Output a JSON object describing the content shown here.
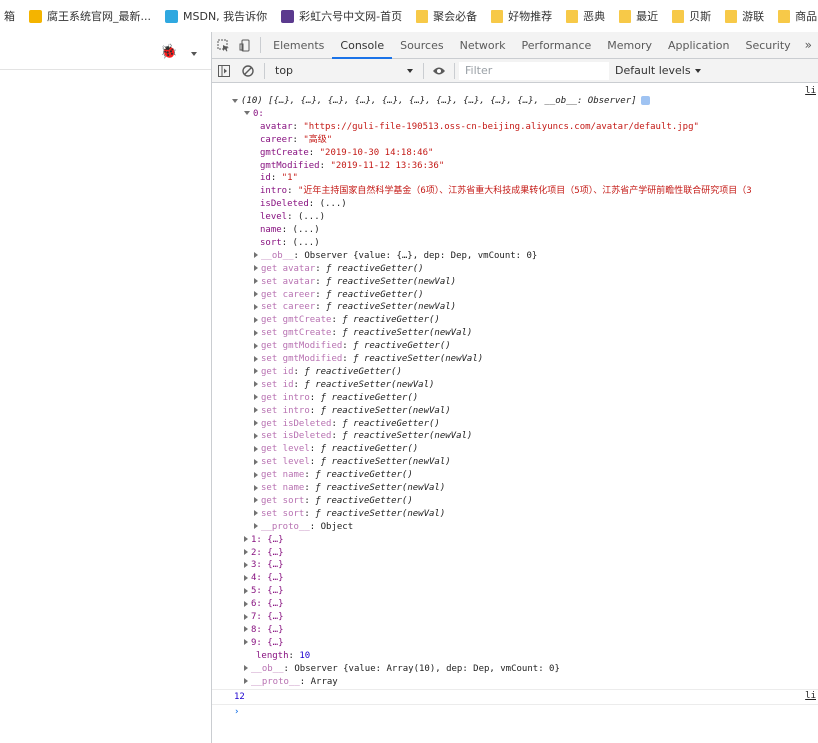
{
  "bookmarks": [
    {
      "label": "箱",
      "color": "#ffffff"
    },
    {
      "label": "腐王系统官网_最新...",
      "color": "#f4b400"
    },
    {
      "label": "MSDN, 我告诉你",
      "color": "#2fa8e0"
    },
    {
      "label": "彩虹六号中文网-首页",
      "color": "#5b3a8e"
    },
    {
      "label": "聚会必备",
      "color": "#f7c948"
    },
    {
      "label": "好物推荐",
      "color": "#f7c948"
    },
    {
      "label": "恶典",
      "color": "#f7c948"
    },
    {
      "label": "最近",
      "color": "#f7c948"
    },
    {
      "label": "贝斯",
      "color": "#f7c948"
    },
    {
      "label": "游联",
      "color": "#f7c948"
    },
    {
      "label": "商品",
      "color": "#f7c948"
    }
  ],
  "devtools": {
    "tabs": [
      "Elements",
      "Console",
      "Sources",
      "Network",
      "Performance",
      "Memory",
      "Application",
      "Security"
    ],
    "active_tab": "Console",
    "more": "»",
    "context": "top",
    "filter_placeholder": "Filter",
    "levels": "Default levels"
  },
  "console": {
    "header": "(10) [{…}, {…}, {…}, {…}, {…}, {…}, {…}, {…}, {…}, {…}, __ob__: Observer]",
    "source": "li",
    "item0_key": "0:",
    "fields": [
      {
        "key": "avatar",
        "value": "\"https://guli-file-190513.oss-cn-beijing.aliyuncs.com/avatar/default.jpg\"",
        "type": "str"
      },
      {
        "key": "career",
        "value": "\"高级\"",
        "type": "str"
      },
      {
        "key": "gmtCreate",
        "value": "\"2019-10-30 14:18:46\"",
        "type": "str"
      },
      {
        "key": "gmtModified",
        "value": "\"2019-11-12 13:36:36\"",
        "type": "str"
      },
      {
        "key": "id",
        "value": "\"1\"",
        "type": "str"
      },
      {
        "key": "intro",
        "value": "\"近年主持国家自然科学基金（6项）、江苏省重大科技成果转化项目（5项）、江苏省产学研前瞻性联合研究项目（3",
        "type": "str"
      },
      {
        "key": "isDeleted",
        "value": "(...)",
        "type": "plain"
      },
      {
        "key": "level",
        "value": "(...)",
        "type": "plain"
      },
      {
        "key": "name",
        "value": "(...)",
        "type": "plain"
      },
      {
        "key": "sort",
        "value": "(...)",
        "type": "plain"
      }
    ],
    "observer_line": {
      "key": "__ob__",
      "value": "Observer {value: {…}, dep: Dep, vmCount: 0}"
    },
    "accessors": [
      {
        "key": "get avatar",
        "value": "reactiveGetter()"
      },
      {
        "key": "set avatar",
        "value": "reactiveSetter(newVal)"
      },
      {
        "key": "get career",
        "value": "reactiveGetter()"
      },
      {
        "key": "set career",
        "value": "reactiveSetter(newVal)"
      },
      {
        "key": "get gmtCreate",
        "value": "reactiveGetter()"
      },
      {
        "key": "set gmtCreate",
        "value": "reactiveSetter(newVal)"
      },
      {
        "key": "get gmtModified",
        "value": "reactiveGetter()"
      },
      {
        "key": "set gmtModified",
        "value": "reactiveSetter(newVal)"
      },
      {
        "key": "get id",
        "value": "reactiveGetter()"
      },
      {
        "key": "set id",
        "value": "reactiveSetter(newVal)"
      },
      {
        "key": "get intro",
        "value": "reactiveGetter()"
      },
      {
        "key": "set intro",
        "value": "reactiveSetter(newVal)"
      },
      {
        "key": "get isDeleted",
        "value": "reactiveGetter()"
      },
      {
        "key": "set isDeleted",
        "value": "reactiveSetter(newVal)"
      },
      {
        "key": "get level",
        "value": "reactiveGetter()"
      },
      {
        "key": "set level",
        "value": "reactiveSetter(newVal)"
      },
      {
        "key": "get name",
        "value": "reactiveGetter()"
      },
      {
        "key": "set name",
        "value": "reactiveSetter(newVal)"
      },
      {
        "key": "get sort",
        "value": "reactiveGetter()"
      },
      {
        "key": "set sort",
        "value": "reactiveSetter(newVal)"
      }
    ],
    "proto_obj": {
      "key": "__proto__",
      "value": "Object"
    },
    "items": [
      "1: {…}",
      "2: {…}",
      "3: {…}",
      "4: {…}",
      "5: {…}",
      "6: {…}",
      "7: {…}",
      "8: {…}",
      "9: {…}"
    ],
    "length": {
      "key": "length",
      "value": "10"
    },
    "array_observer": {
      "key": "__ob__",
      "value": "Observer {value: Array(10), dep: Dep, vmCount: 0}"
    },
    "array_proto": {
      "key": "__proto__",
      "value": "Array"
    },
    "result": "12",
    "result_source": "li",
    "prompt": "›"
  }
}
